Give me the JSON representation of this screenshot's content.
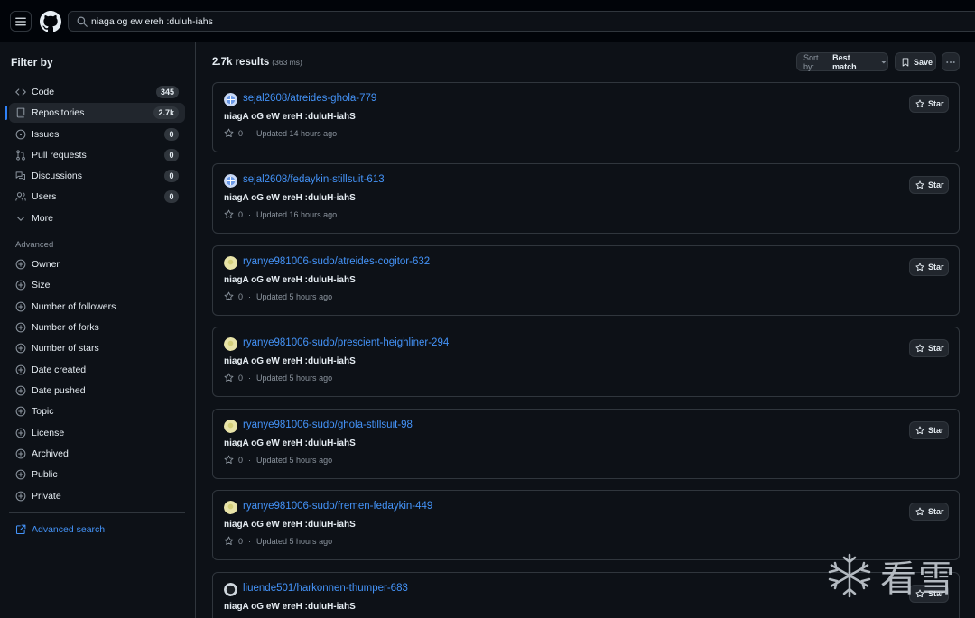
{
  "header": {
    "search_value": "niaga og ew ereh :duluh-iahs"
  },
  "sidebar": {
    "title": "Filter by",
    "types": [
      {
        "label": "Code",
        "count": "345",
        "icon": "code-icon"
      },
      {
        "label": "Repositories",
        "count": "2.7k",
        "icon": "repo-icon",
        "active": true
      },
      {
        "label": "Issues",
        "count": "0",
        "icon": "issue-icon"
      },
      {
        "label": "Pull requests",
        "count": "0",
        "icon": "pull-request-icon"
      },
      {
        "label": "Discussions",
        "count": "0",
        "icon": "discussion-icon"
      },
      {
        "label": "Users",
        "count": "0",
        "icon": "people-icon"
      },
      {
        "label": "More",
        "icon": "chevron-down-icon"
      }
    ],
    "advanced_heading": "Advanced",
    "advanced": [
      "Owner",
      "Size",
      "Number of followers",
      "Number of forks",
      "Number of stars",
      "Date created",
      "Date pushed",
      "Topic",
      "License",
      "Archived",
      "Public",
      "Private"
    ],
    "advanced_search_link": "Advanced search"
  },
  "main": {
    "results_count": "2.7k results",
    "results_time": "(363 ms)",
    "sort_label": "Sort by:",
    "sort_value": "Best match",
    "save_label": "Save",
    "star_label": "Star",
    "results": [
      {
        "name": "sejal2608/atreides-ghola-779",
        "description": "niagA oG eW ereH :duluH-iahS",
        "stars": "0",
        "updated": "Updated 14 hours ago",
        "avatar": "blue-globe"
      },
      {
        "name": "sejal2608/fedaykin-stillsuit-613",
        "description": "niagA oG eW ereH :duluH-iahS",
        "stars": "0",
        "updated": "Updated 16 hours ago",
        "avatar": "blue-globe"
      },
      {
        "name": "ryanye981006-sudo/atreides-cogitor-632",
        "description": "niagA oG eW ereH :duluH-iahS",
        "stars": "0",
        "updated": "Updated 5 hours ago",
        "avatar": "yellow"
      },
      {
        "name": "ryanye981006-sudo/prescient-heighliner-294",
        "description": "niagA oG eW ereH :duluH-iahS",
        "stars": "0",
        "updated": "Updated 5 hours ago",
        "avatar": "yellow"
      },
      {
        "name": "ryanye981006-sudo/ghola-stillsuit-98",
        "description": "niagA oG eW ereH :duluH-iahS",
        "stars": "0",
        "updated": "Updated 5 hours ago",
        "avatar": "yellow"
      },
      {
        "name": "ryanye981006-sudo/fremen-fedaykin-449",
        "description": "niagA oG eW ereH :duluH-iahS",
        "stars": "0",
        "updated": "Updated 5 hours ago",
        "avatar": "yellow"
      },
      {
        "name": "liuende501/harkonnen-thumper-683",
        "description": "niagA oG eW ereH :duluH-iahS",
        "stars": "",
        "updated": "",
        "avatar": "dark"
      }
    ]
  },
  "watermark": {
    "text": "看雪"
  },
  "colors": {
    "background": "#0d1117",
    "header": "#010409",
    "border": "#30363d",
    "link": "#4493f8",
    "accent": "#2f81f7",
    "muted": "#8b949e"
  }
}
